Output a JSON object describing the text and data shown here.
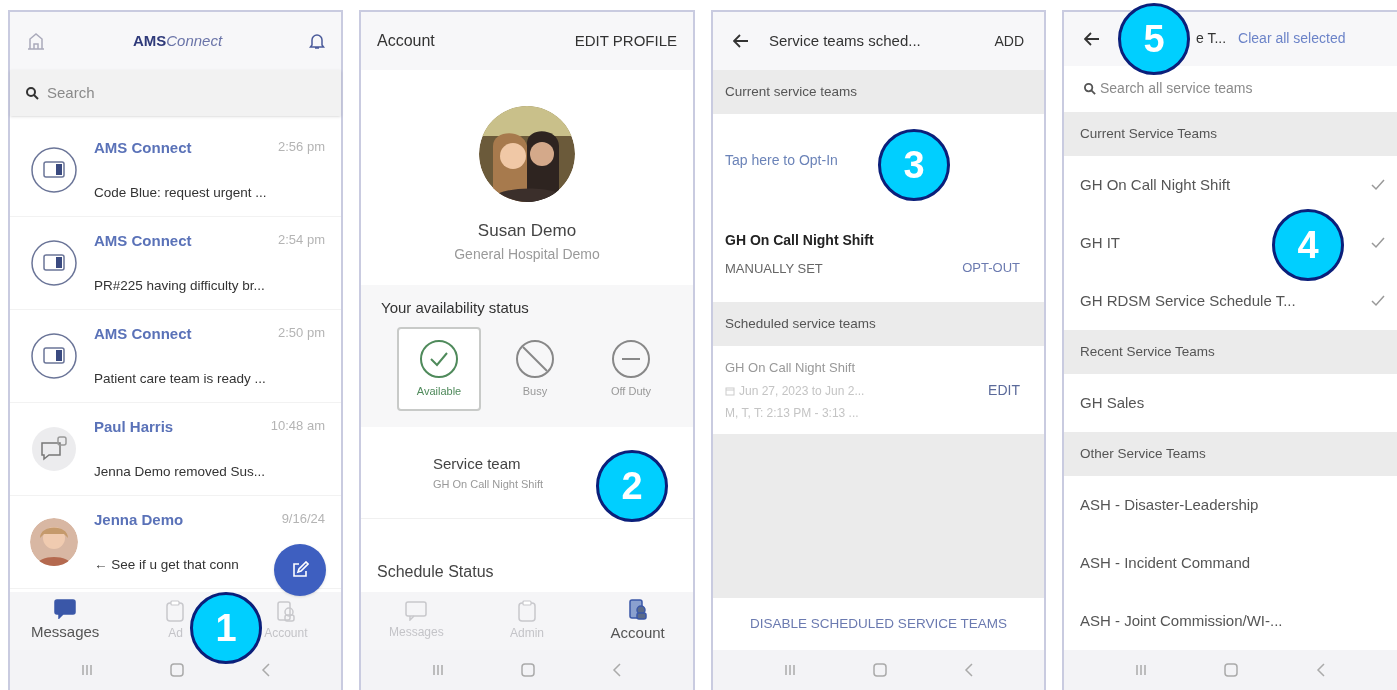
{
  "messages_screen": {
    "logo": {
      "part_1": "AMS",
      "part_2": "Connect"
    },
    "search": {
      "placeholder": "Search"
    },
    "conversations": [
      {
        "sender": "AMS Connect",
        "time": "2:56 pm",
        "preview": "Code Blue: request urgent ...",
        "kind": "app"
      },
      {
        "sender": "AMS Connect",
        "time": "2:54 pm",
        "preview": "PR#225 having difficulty br...",
        "kind": "app"
      },
      {
        "sender": "AMS Connect",
        "time": "2:50 pm",
        "preview": "Patient care team is ready ...",
        "kind": "app"
      },
      {
        "sender": "Paul Harris",
        "time": "10:48 am",
        "preview": "Jenna Demo removed Sus...",
        "kind": "group"
      },
      {
        "sender": "Jenna Demo",
        "time": "9/16/24",
        "preview": "← See if u get that conn"
      }
    ],
    "tabs": [
      {
        "label": "Messages",
        "selected": true
      },
      {
        "label": "Ad",
        "selected": false
      },
      {
        "label": "Account",
        "selected": false
      }
    ],
    "callout": "1"
  },
  "account_screen": {
    "title": "Account",
    "action": "EDIT PROFILE",
    "name": "Susan Demo",
    "organization": "General Hospital Demo",
    "availability": {
      "heading": "Your availability status",
      "options": [
        {
          "label": "Available",
          "kind": "available",
          "selected": true
        },
        {
          "label": "Busy",
          "kind": "busy",
          "selected": false
        },
        {
          "label": "Off Duty",
          "kind": "off",
          "selected": false
        }
      ]
    },
    "service_team": {
      "label": "Service team",
      "value": "GH On Call Night Shift"
    },
    "schedule_heading": "Schedule Status",
    "tabs": [
      {
        "label": "Messages",
        "selected": false
      },
      {
        "label": "Admin",
        "selected": false
      },
      {
        "label": "Account",
        "selected": true
      }
    ],
    "callout": "2"
  },
  "service_teams_screen": {
    "title": "Service teams sched...",
    "action": "ADD",
    "current_heading": "Current service teams",
    "opt_in": "Tap here to Opt-In",
    "current_team": {
      "name": "GH On Call Night Shift",
      "mode": "MANUALLY SET",
      "action": "OPT-OUT"
    },
    "scheduled_heading": "Scheduled service teams",
    "scheduled_team": {
      "name": "GH On Call Night Shift",
      "dates": "Jun 27, 2023 to Jun 2...",
      "days": "M, T, T: 2:13 PM - 3:13 ...",
      "action": "EDIT"
    },
    "footer_action": "DISABLE SCHEDULED SERVICE TEAMS",
    "callout": "3"
  },
  "team_picker_screen": {
    "title": "e T...",
    "action": "Clear all selected",
    "search": {
      "placeholder": "Search all service teams"
    },
    "groups": [
      {
        "heading": "Current Service Teams",
        "teams": [
          {
            "name": "GH On Call Night Shift",
            "checked": true
          },
          {
            "name": "GH IT",
            "checked": true
          },
          {
            "name": "GH RDSM Service Schedule T...",
            "checked": true
          }
        ]
      },
      {
        "heading": "Recent Service Teams",
        "teams": [
          {
            "name": "GH Sales",
            "checked": false
          }
        ]
      },
      {
        "heading": "Other Service Teams",
        "teams": [
          {
            "name": "ASH - Disaster-Leadership",
            "checked": false
          },
          {
            "name": "ASH - Incident Command",
            "checked": false
          },
          {
            "name": "ASH - Joint Commission/WI-...",
            "checked": false
          }
        ]
      }
    ],
    "callouts": [
      "5",
      "4"
    ]
  }
}
